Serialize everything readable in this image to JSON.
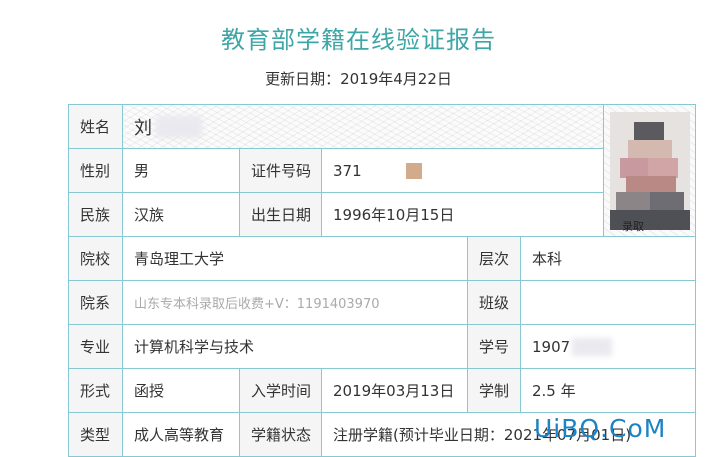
{
  "header": {
    "title": "教育部学籍在线验证报告",
    "update_date": "更新日期：2019年4月22日"
  },
  "record": {
    "name_label": "姓名",
    "name_value": "刘",
    "gender_label": "性别",
    "gender_value": "男",
    "id_label": "证件号码",
    "id_value": "371",
    "ethnicity_label": "民族",
    "ethnicity_value": "汉族",
    "birth_label": "出生日期",
    "birth_value": "1996年10月15日",
    "school_label": "院校",
    "school_value": "青岛理工大学",
    "level_label": "层次",
    "level_value": "本科",
    "department_label": "院系",
    "department_value": "山东专本科录取后收费+V：1191403970",
    "class_label": "班级",
    "class_value": "",
    "major_label": "专业",
    "major_value": "计算机科学与技术",
    "student_no_label": "学号",
    "student_no_value": "1907",
    "form_label": "形式",
    "form_value": "函授",
    "enroll_label": "入学时间",
    "enroll_value": "2019年03月13日",
    "duration_label": "学制",
    "duration_value": "2.5 年",
    "type_label": "类型",
    "type_value": "成人高等教育",
    "status_label": "学籍状态",
    "status_value": "注册学籍(预计毕业日期：2021年07月01日)"
  },
  "photo": {
    "caption": "录取"
  },
  "watermark": "UiBQ.CoM",
  "colors": {
    "title": "#3ea6a6",
    "border": "#88c8d4",
    "label_bg": "#f5f5f5",
    "watermark": "#1c83c4"
  }
}
